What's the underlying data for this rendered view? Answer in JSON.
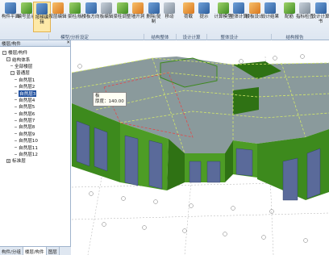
{
  "ribbon": {
    "buttons": [
      {
        "label": "构件平面",
        "icon": "grid-icon"
      },
      {
        "label": "编号显示",
        "icon": "number-icon"
      },
      {
        "label": "按梯编辑",
        "icon": "stair-icon"
      },
      {
        "label": "按层编辑",
        "icon": "layer-edit-icon"
      },
      {
        "label": "梁柱/板",
        "icon": "beam-icon"
      },
      {
        "label": "楼板方向",
        "icon": "slab-direction-icon"
      },
      {
        "label": "板编辑",
        "icon": "slab-edit-icon"
      },
      {
        "label": "梁柱调整",
        "icon": "column-icon"
      },
      {
        "label": "墙开洞",
        "icon": "opening-icon"
      },
      {
        "label": "删除/复制",
        "icon": "copy-icon"
      },
      {
        "label": "移动",
        "icon": "move-icon"
      },
      {
        "label": "荷载",
        "icon": "load-icon"
      },
      {
        "label": "提示",
        "icon": "hint-icon"
      },
      {
        "label": "计算模型",
        "icon": "calc-icon"
      },
      {
        "label": "整体计算",
        "icon": "compute-icon"
      },
      {
        "label": "楼板设计",
        "icon": "slab-design-icon"
      },
      {
        "label": "设计结果",
        "icon": "result-icon"
      },
      {
        "label": "配筋",
        "icon": "rebar-icon"
      },
      {
        "label": "指标检查",
        "icon": "check-icon"
      },
      {
        "label": "设计计算书",
        "icon": "report-icon"
      }
    ],
    "groups": [
      "模型/分析设定",
      "结构整体",
      "设计计算",
      "整体设计",
      "结构报告"
    ]
  },
  "panel": {
    "title": "楼层/构件",
    "tree": [
      {
        "label": "楼层/构件",
        "indent": 0,
        "expander": "-"
      },
      {
        "label": "结构体系",
        "indent": 1,
        "expander": "-"
      },
      {
        "label": "全部楼层",
        "indent": 2,
        "expander": ""
      },
      {
        "label": "普通层",
        "indent": 2,
        "expander": "-"
      },
      {
        "label": "自然层1",
        "indent": 3,
        "expander": ""
      },
      {
        "label": "自然层2",
        "indent": 3,
        "expander": ""
      },
      {
        "label": "自然层3",
        "indent": 3,
        "expander": "",
        "selected": true
      },
      {
        "label": "自然层4",
        "indent": 3,
        "expander": ""
      },
      {
        "label": "自然层5",
        "indent": 3,
        "expander": ""
      },
      {
        "label": "自然层6",
        "indent": 3,
        "expander": ""
      },
      {
        "label": "自然层7",
        "indent": 3,
        "expander": ""
      },
      {
        "label": "自然层8",
        "indent": 3,
        "expander": ""
      },
      {
        "label": "自然层9",
        "indent": 3,
        "expander": ""
      },
      {
        "label": "自然层10",
        "indent": 3,
        "expander": ""
      },
      {
        "label": "自然层11",
        "indent": 3,
        "expander": ""
      },
      {
        "label": "自然层12",
        "indent": 3,
        "expander": ""
      },
      {
        "label": "标准层",
        "indent": 1,
        "expander": "+"
      }
    ],
    "tabs": [
      "构件/分组",
      "楼层/构件",
      "图层"
    ]
  },
  "tooltip": {
    "line1": "板",
    "line2": "厚度：140.00"
  }
}
